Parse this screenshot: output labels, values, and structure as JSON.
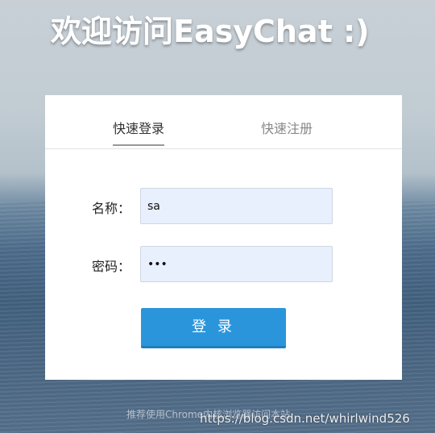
{
  "header": {
    "title": "欢迎访问EasyChat :)"
  },
  "tabs": [
    {
      "label": "快速登录",
      "active": true
    },
    {
      "label": "快速注册",
      "active": false
    }
  ],
  "form": {
    "username_label": "名称：",
    "username_value": "sa",
    "password_label": "密码：",
    "password_value": "•••",
    "submit_label": "登 录"
  },
  "footer": {
    "note": "推荐使用Chrome内核浏览器访问本站",
    "watermark": "https://blog.csdn.net/whirlwind526"
  },
  "colors": {
    "button": "#2b95dc",
    "input_bg": "#e8effd"
  }
}
